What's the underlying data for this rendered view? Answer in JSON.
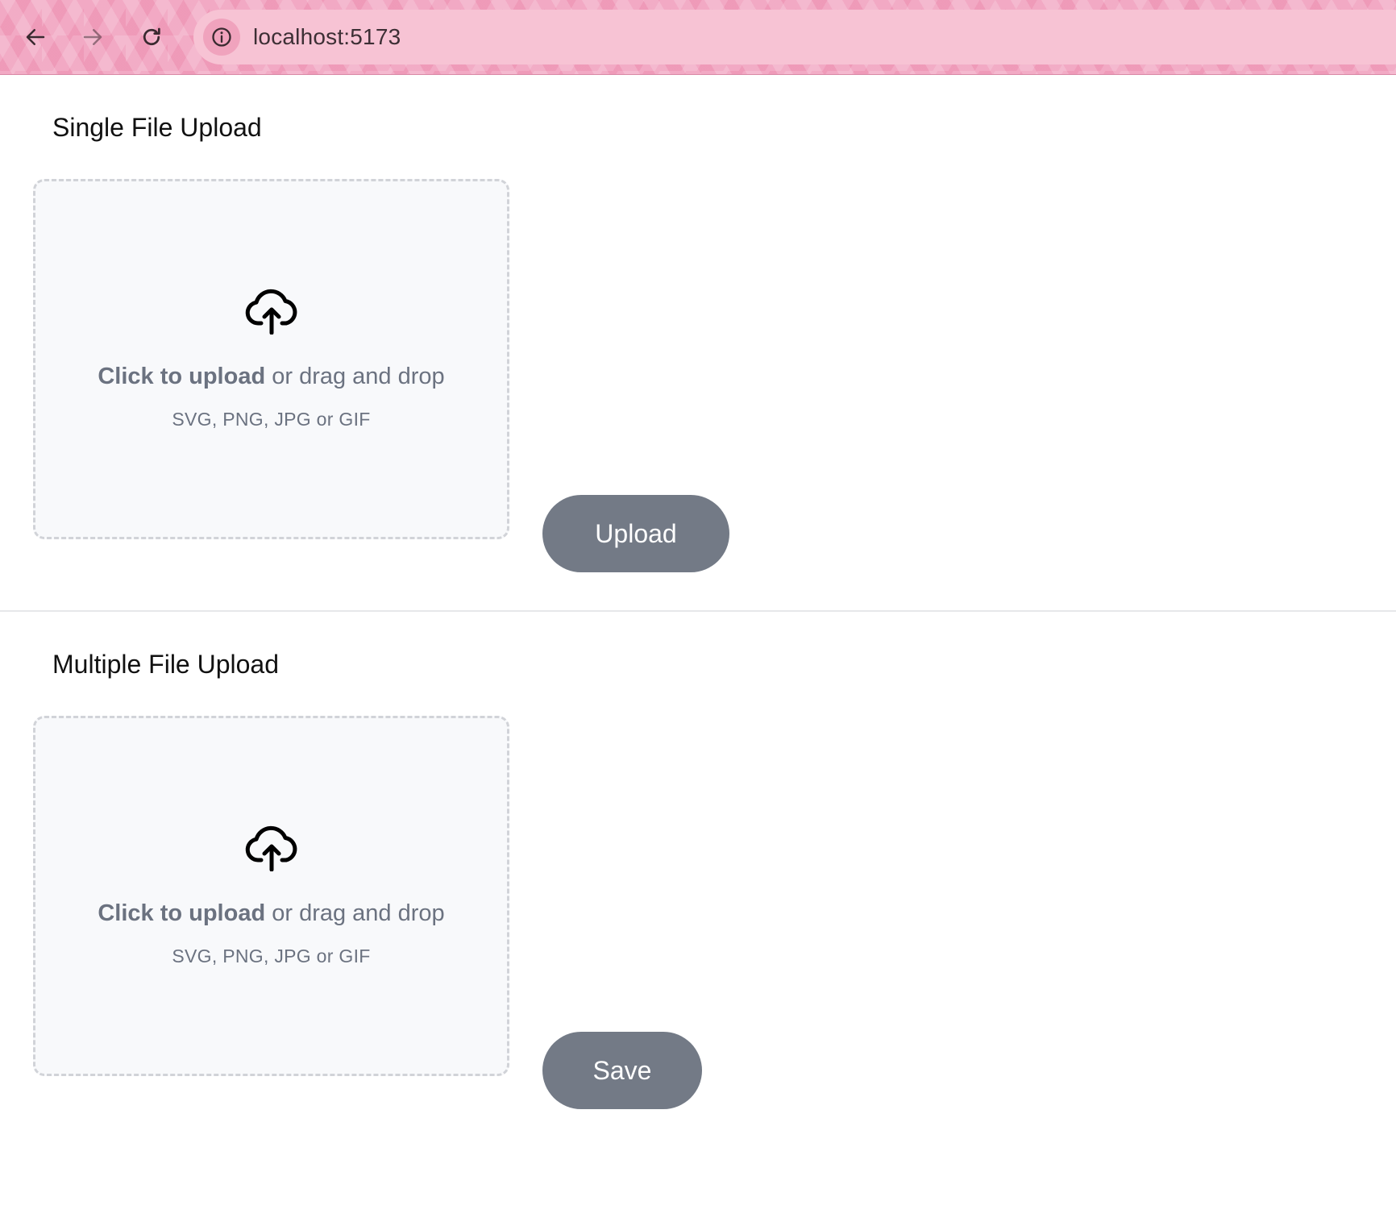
{
  "browser": {
    "url": "localhost:5173"
  },
  "single_upload": {
    "title": "Single File Upload",
    "drop_bold": "Click to upload",
    "drop_rest": "or drag and drop",
    "hint": "SVG, PNG, JPG or GIF",
    "button_label": "Upload"
  },
  "multiple_upload": {
    "title": "Multiple File Upload",
    "drop_bold": "Click to upload",
    "drop_rest": "or drag and drop",
    "hint": "SVG, PNG, JPG or GIF",
    "button_label": "Save"
  },
  "colors": {
    "chrome_pink": "#f2a9c4",
    "button_gray": "#737a86",
    "dropzone_bg": "#f8f9fb",
    "muted_text": "#6b7280"
  }
}
